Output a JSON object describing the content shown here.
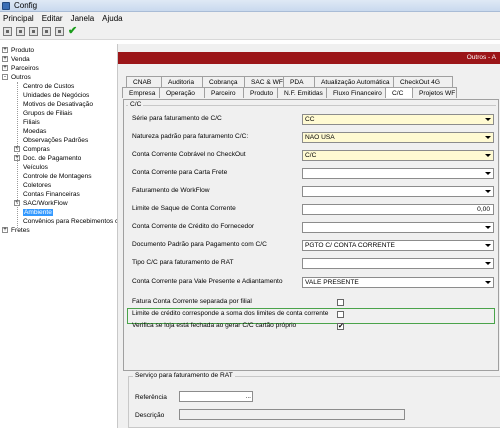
{
  "window": {
    "title": "Config"
  },
  "menu": [
    "Principal",
    "Editar",
    "Janela",
    "Ajuda"
  ],
  "menu_underline": [
    "P",
    "E",
    "J",
    "A"
  ],
  "toolbar": {
    "check_icon": "✔"
  },
  "tree": {
    "items": [
      {
        "label": "Produto",
        "expander": "+"
      },
      {
        "label": "Venda",
        "expander": "+"
      },
      {
        "label": "Parceiros",
        "expander": "+"
      },
      {
        "label": "Outros",
        "expander": "-"
      },
      {
        "label": "Centro de Custos"
      },
      {
        "label": "Unidades de Negócios"
      },
      {
        "label": "Motivos de Desativação"
      },
      {
        "label": "Grupos de Filiais"
      },
      {
        "label": "Filiais"
      },
      {
        "label": "Moedas"
      },
      {
        "label": "Observações Padrões"
      },
      {
        "label": "Compras",
        "expander": "+"
      },
      {
        "label": "Doc. de Pagamento",
        "expander": "+"
      },
      {
        "label": "Veículos"
      },
      {
        "label": "Controle de Montagens"
      },
      {
        "label": "Coletores"
      },
      {
        "label": "Contas Financeiras"
      },
      {
        "label": "SAC/WorkFlow",
        "expander": "+"
      },
      {
        "label": "Ambiente",
        "selected": true
      },
      {
        "label": "Convênios para Recebimentos c"
      },
      {
        "label": "Fretes",
        "expander": "+"
      }
    ]
  },
  "header": {
    "title": "Outros - A"
  },
  "tabs_row1": [
    "CNAB",
    "Auditoria",
    "Cobrança",
    "SAC & WF",
    "PDA",
    "Atualização Automática",
    "CheckOut 4G"
  ],
  "tabs_row2": [
    "Empresa",
    "Operação",
    "Parceiro",
    "Produto",
    "N.F. Emitidas",
    "Fluxo Financeiro",
    "C/C",
    "Projetos WF"
  ],
  "active_tab": "C/C",
  "cc_group": {
    "label": "C/C"
  },
  "fields": [
    {
      "label": "Série para faturamento de C/C",
      "value": "CC",
      "filled": true,
      "type": "combo"
    },
    {
      "label": "Natureza padrão para faturamento C/C:",
      "value": "NAO USA",
      "filled": true,
      "type": "combo"
    },
    {
      "label": "Conta Corrente Cobrável no CheckOut",
      "value": "C/C",
      "filled": true,
      "type": "combo"
    },
    {
      "label": "Conta Corrente para Carta Frete",
      "value": "",
      "type": "combo"
    },
    {
      "label": "Faturamento de WorkFlow",
      "value": "",
      "type": "combo"
    },
    {
      "label": "Limite de Saque de Conta Corrente",
      "value": "0,00",
      "type": "number"
    },
    {
      "label": "Conta Corrente de Crédito do Fornecedor",
      "value": "",
      "type": "combo"
    },
    {
      "label": "Documento Padrão para Pagamento com C/C",
      "value": "PGTO C/ CONTA CORRENTE",
      "type": "combo"
    },
    {
      "label": "Tipo C/C para faturamento de RAT",
      "value": "",
      "type": "combo"
    },
    {
      "label": "Conta Corrente para Vale Presente e Adiantamento",
      "value": "VALE PRESENTE",
      "type": "combo"
    }
  ],
  "checkboxes": [
    {
      "label": "Fatura Conta Corrente separada por filial",
      "checked": false,
      "mark": ""
    },
    {
      "label": "Limite de crédito corresponde a soma dos limites de conta corrente",
      "checked": false,
      "mark": ""
    },
    {
      "label": "Verifica se loja está fechada ao gerar C/C cartão próprio",
      "checked": true,
      "mark": "✔"
    }
  ],
  "rat_group": {
    "label": "Serviço para faturamento de RAT",
    "referencia_label": "Referência",
    "referencia_value": "",
    "referencia_button": "...",
    "descricao_label": "Descrição",
    "descricao_value": ""
  },
  "colors": {
    "header_red": "#9b1518",
    "field_yellow": "#fffad2",
    "highlight_green": "#4aa34a",
    "selection_blue": "#3399ff"
  }
}
